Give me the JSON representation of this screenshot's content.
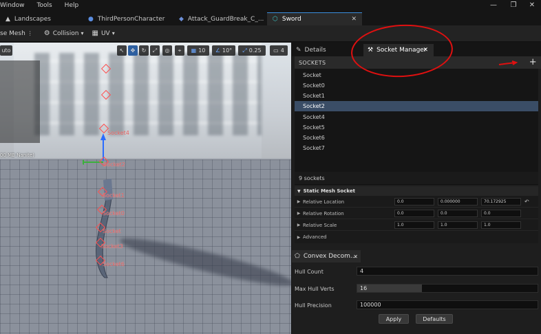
{
  "menu": {
    "items": [
      "Window",
      "Tools",
      "Help"
    ]
  },
  "window_controls": {
    "minimize": "—",
    "restore": "❐",
    "close": "✕"
  },
  "tabs": [
    {
      "label": "Landscapes",
      "icon": "landscape-icon"
    },
    {
      "label": "ThirdPersonCharacter",
      "icon": "character-icon"
    },
    {
      "label": "Attack_GuardBreak_C_...",
      "icon": "animation-icon"
    },
    {
      "label": "Sword",
      "icon": "static-mesh-icon",
      "active": true
    }
  ],
  "toolbar": {
    "mesh_label": "se Mesh",
    "collision_label": "Collision",
    "uv_label": "UV"
  },
  "viewport": {
    "auto_label": "uto",
    "info_text": "00 MB Nanite)",
    "grid_snap": "10",
    "angle_snap": "10°",
    "scale_snap": "0.25",
    "camera_speed": "4",
    "socket_labels": [
      "Socket4",
      "Socket2",
      "Socket1",
      "Socket0",
      "Socket",
      "Socket3",
      "Socket6"
    ]
  },
  "panel_tabs": {
    "details": "Details",
    "socket_manager": "Socket Manager"
  },
  "sockets": {
    "header": "SOCKETS",
    "add_label": "+",
    "items": [
      "Socket",
      "Socket0",
      "Socket1",
      "Socket2",
      "Socket4",
      "Socket5",
      "Socket6",
      "Socket7"
    ],
    "selected_index": 3,
    "count_text": "9 sockets"
  },
  "details": {
    "section": "Static Mesh Socket",
    "rows": [
      {
        "label": "Relative Location",
        "values": [
          "0.0",
          "0.000000",
          "70.172925"
        ]
      },
      {
        "label": "Relative Rotation",
        "values": [
          "0.0",
          "0.0",
          "0.0"
        ]
      },
      {
        "label": "Relative Scale",
        "values": [
          "1.0",
          "1.0",
          "1.0"
        ]
      },
      {
        "label": "Advanced",
        "values": []
      }
    ]
  },
  "convex": {
    "tab_label": "Convex Decom...",
    "hull_count_label": "Hull Count",
    "hull_count_value": "4",
    "max_hull_verts_label": "Max Hull Verts",
    "max_hull_verts_value": "16",
    "max_hull_verts_fill": 0.36,
    "hull_precision_label": "Hull Precision",
    "hull_precision_value": "100000",
    "apply_label": "Apply",
    "defaults_label": "Defaults"
  },
  "colors": {
    "accent": "#3b8fe0",
    "selection": "#3a4d66",
    "annotation": "#e01010",
    "socket": "#e05a5a"
  }
}
